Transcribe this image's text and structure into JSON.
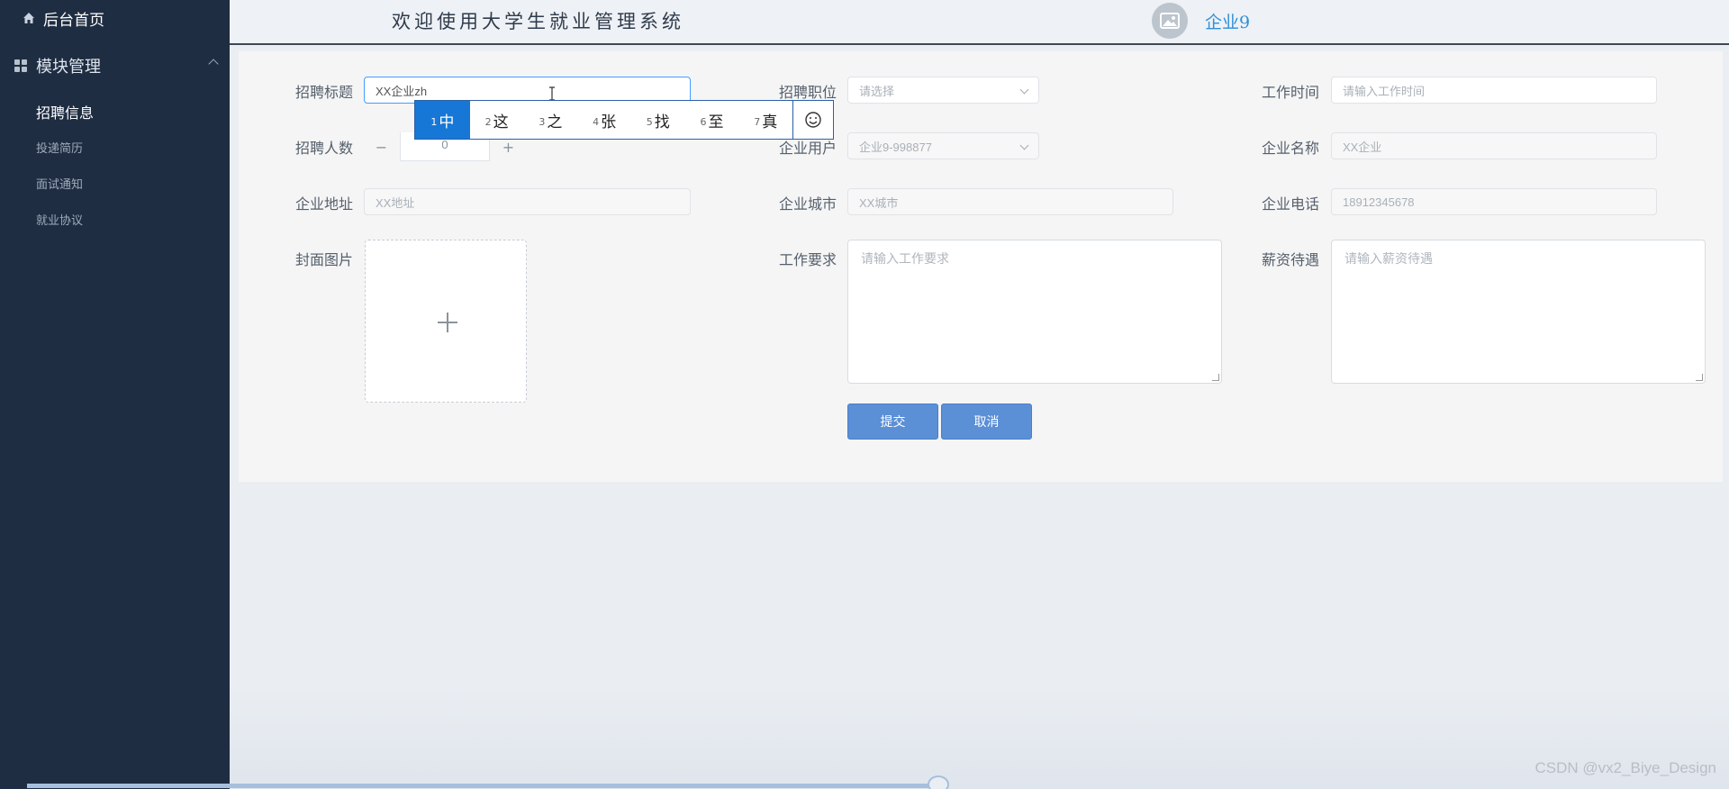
{
  "sidebar": {
    "home_label": "后台首页",
    "module_label": "模块管理",
    "items": [
      {
        "label": "招聘信息",
        "active": true
      },
      {
        "label": "投递简历",
        "active": false
      },
      {
        "label": "面试通知",
        "active": false
      },
      {
        "label": "就业协议",
        "active": false
      }
    ]
  },
  "header": {
    "title": "欢迎使用大学生就业管理系统",
    "user_name": "企业9"
  },
  "form": {
    "title_label": "招聘标题",
    "title_value": "XX企业zh",
    "position_label": "招聘职位",
    "position_placeholder": "请选择",
    "worktime_label": "工作时间",
    "worktime_placeholder": "请输入工作时间",
    "count_label": "招聘人数",
    "count_value": "0",
    "company_user_label": "企业用户",
    "company_user_value": "企业9-998877",
    "company_name_label": "企业名称",
    "company_name_value": "XX企业",
    "address_label": "企业地址",
    "address_value": "XX地址",
    "city_label": "企业城市",
    "city_value": "XX城市",
    "phone_label": "企业电话",
    "phone_value": "18912345678",
    "cover_label": "封面图片",
    "requirement_label": "工作要求",
    "requirement_placeholder": "请输入工作要求",
    "salary_label": "薪资待遇",
    "salary_placeholder": "请输入薪资待遇",
    "submit_label": "提交",
    "cancel_label": "取消"
  },
  "ime": {
    "candidates": [
      {
        "num": "1",
        "text": "中"
      },
      {
        "num": "2",
        "text": "这"
      },
      {
        "num": "3",
        "text": "之"
      },
      {
        "num": "4",
        "text": "张"
      },
      {
        "num": "5",
        "text": "找"
      },
      {
        "num": "6",
        "text": "至"
      },
      {
        "num": "7",
        "text": "真"
      }
    ],
    "emoji_icon": "smiley-icon"
  },
  "watermark": "CSDN @vx2_Biye_Design",
  "colors": {
    "sidebar_bg": "#1f2d42",
    "accent": "#409eff",
    "button": "#5b8fd6",
    "ime_selected": "#1777d6"
  }
}
